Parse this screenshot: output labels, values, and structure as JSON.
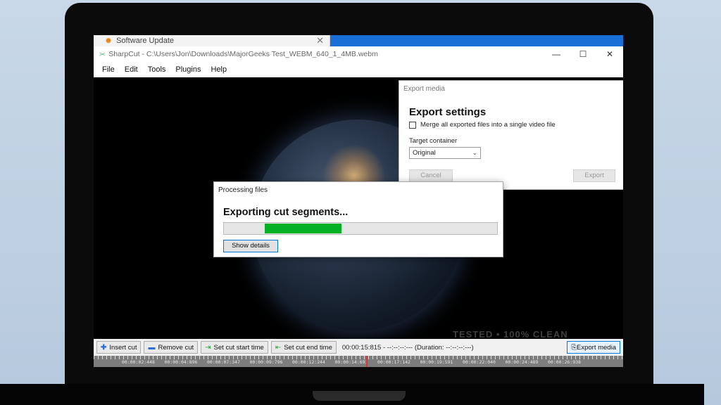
{
  "update_tab": {
    "title": "Software Update"
  },
  "window": {
    "title": "SharpCut - C:\\Users\\Jon\\Downloads\\MajorGeeks Test_WEBM_640_1_4MB.webm",
    "controls": {
      "minimize": "—",
      "maximize": "☐",
      "close": "✕"
    }
  },
  "menu": [
    "File",
    "Edit",
    "Tools",
    "Plugins",
    "Help"
  ],
  "export_dialog": {
    "title": "Export media",
    "heading": "Export settings",
    "merge_label": "Merge all exported files into a single video file",
    "merge_checked": false,
    "container_label": "Target container",
    "container_value": "Original",
    "cancel_label": "Cancel",
    "export_label": "Export"
  },
  "processing_dialog": {
    "title": "Processing files",
    "heading": "Exporting cut segments...",
    "progress_start": 0.15,
    "progress_end": 0.43,
    "details_label": "Show details",
    "progress_color": "#06b025"
  },
  "toolbar": {
    "insert_cut": "Insert cut",
    "remove_cut": "Remove cut",
    "set_start": "Set cut start time",
    "set_end": "Set cut end time",
    "time_readout": "00:00:15:815 - --:--:--:--- (Duration: --:--:--:---)",
    "export_media": "Export media"
  },
  "watermark": "TESTED • 100% CLEAN",
  "timeline": {
    "labels": [
      "00:00:02:448",
      "00:00:04:896",
      "00:00:07:347",
      "00:00:09:796",
      "00:00:12:244",
      "00:00:14:693",
      "00:00:17:142",
      "00:00:19:591",
      "00:00:22:040",
      "00:00:24:489",
      "00:00:26:938"
    ]
  }
}
